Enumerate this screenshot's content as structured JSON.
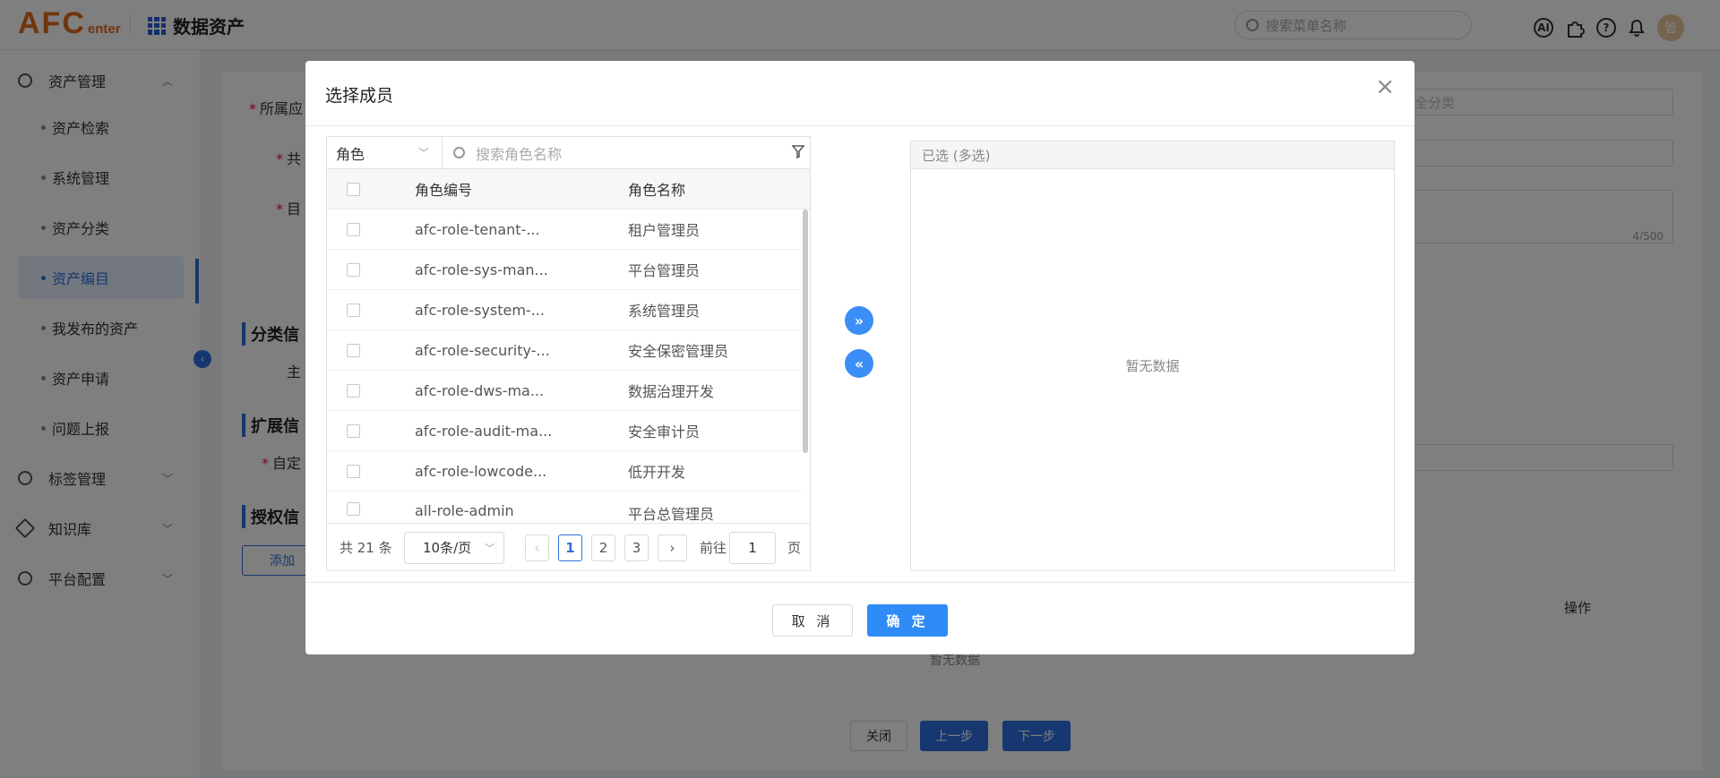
{
  "header": {
    "logo_big": "AFC",
    "logo_small": "enter",
    "app_title": "数据资产",
    "search_placeholder": "搜索菜单名称",
    "ai_icon_label": "AI",
    "avatar_label": "管"
  },
  "sidebar": {
    "items": [
      {
        "label": "资产管理",
        "expanded": true
      },
      {
        "label": "标签管理"
      },
      {
        "label": "知识库"
      },
      {
        "label": "平台配置"
      }
    ],
    "subitems": [
      {
        "label": "资产检索"
      },
      {
        "label": "系统管理"
      },
      {
        "label": "资产分类"
      },
      {
        "label": "资产编目",
        "active": true
      },
      {
        "label": "我发布的资产"
      },
      {
        "label": "资产申请"
      },
      {
        "label": "问题上报"
      }
    ]
  },
  "background_form": {
    "label_app": "所属应",
    "label_share": "共",
    "label_dir": "目",
    "select_placeholder": "全分类",
    "char_count": "4/500",
    "section_classify": "分类信",
    "label_main": "主",
    "section_extend": "扩展信",
    "label_custom": "自定",
    "section_auth": "授权信",
    "add_button": "添加",
    "col_action": "操作",
    "empty_text": "暂无数据",
    "btn_close": "关闭",
    "btn_prev": "上一步",
    "btn_next": "下一步"
  },
  "dialog": {
    "title": "选择成员",
    "close_symbol": "×",
    "type_select": "角色",
    "search_placeholder": "搜索角色名称",
    "columns": {
      "code": "角色编号",
      "name": "角色名称"
    },
    "rows": [
      {
        "code": "afc-role-tenant-...",
        "name": "租户管理员"
      },
      {
        "code": "afc-role-sys-man...",
        "name": "平台管理员"
      },
      {
        "code": "afc-role-system-...",
        "name": "系统管理员"
      },
      {
        "code": "afc-role-security-...",
        "name": "安全保密管理员"
      },
      {
        "code": "afc-role-dws-ma...",
        "name": "数据治理开发"
      },
      {
        "code": "afc-role-audit-ma...",
        "name": "安全审计员"
      },
      {
        "code": "afc-role-lowcode...",
        "name": "低开开发"
      },
      {
        "code": "all-role-admin",
        "name": "平台总管理员"
      }
    ],
    "pagination": {
      "total": "共 21 条",
      "page_size": "10条/页",
      "pages": [
        "1",
        "2",
        "3"
      ],
      "current_page": 1,
      "goto_label": "前往",
      "goto_value": "1",
      "goto_unit": "页",
      "prev_symbol": "‹",
      "next_symbol": "›"
    },
    "transfer_right_symbol": "»",
    "transfer_left_symbol": "«",
    "selected_header": "已选 (多选)",
    "selected_empty": "暂无数据",
    "cancel_label": "取 消",
    "confirm_label": "确 定"
  },
  "colors": {
    "accent": "#2f6fe0",
    "confirm": "#2f8bf5",
    "transfer_button": "#3a8ef6",
    "logo": "#e06a1b",
    "required": "#ff0044"
  }
}
